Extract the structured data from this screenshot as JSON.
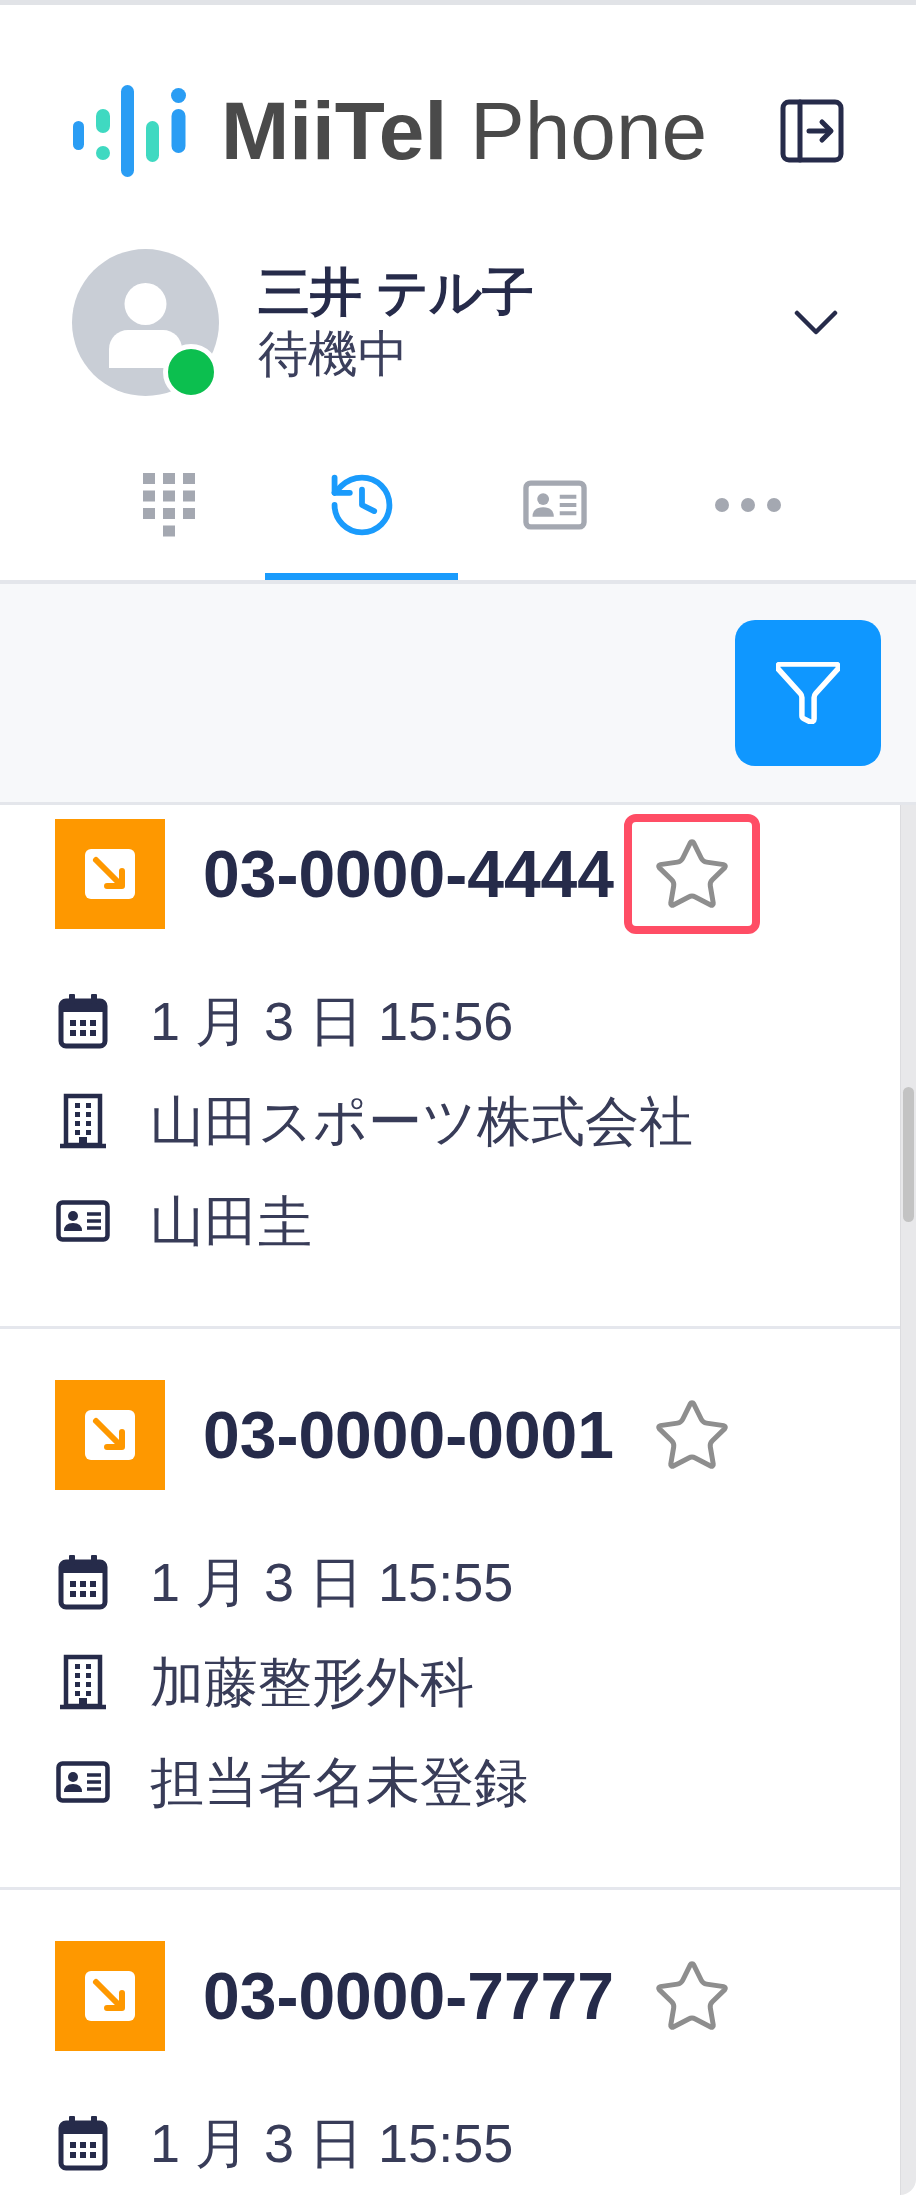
{
  "header": {
    "logo": "**MiiTel** Phone"
  },
  "user": {
    "name": "三井 テル子",
    "status": "待機中",
    "online": true
  },
  "tabs": [
    {
      "kind": "dialpad",
      "selected": false
    },
    {
      "kind": "history",
      "selected": true
    },
    {
      "kind": "contacts",
      "selected": false
    },
    {
      "kind": "more",
      "selected": false
    }
  ],
  "calls": [
    {
      "number": "03-0000-4444",
      "starred": false,
      "highlighted": true,
      "details": [
        {
          "kind": "date",
          "text": "1 月 3 日 15:56"
        },
        {
          "kind": "company",
          "text": "山田スポーツ株式会社"
        },
        {
          "kind": "contact",
          "text": "山田圭"
        }
      ]
    },
    {
      "number": "03-0000-0001",
      "starred": false,
      "highlighted": false,
      "details": [
        {
          "kind": "date",
          "text": "1 月 3 日 15:55"
        },
        {
          "kind": "company",
          "text": "加藤整形外科"
        },
        {
          "kind": "contact",
          "text": "担当者名未登録"
        }
      ]
    },
    {
      "number": "03-0000-7777",
      "starred": false,
      "highlighted": false,
      "details": [
        {
          "kind": "date",
          "text": "1 月 3 日 15:55"
        }
      ]
    }
  ]
}
